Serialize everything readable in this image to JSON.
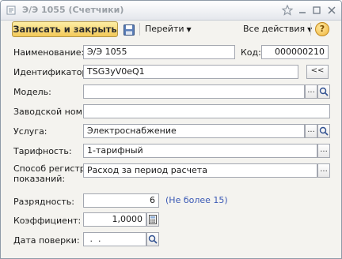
{
  "window": {
    "title": "Э/Э 1055 (Счетчики)"
  },
  "toolbar": {
    "save_close_label": "Записать и закрыть",
    "go_label": "Перейти",
    "actions_label": "Все действия",
    "help_label": "?"
  },
  "form": {
    "name_label": "Наименование:",
    "name_value": "Э/Э 1055",
    "code_label": "Код:",
    "code_value": "000000210",
    "identifier_label": "Идентификатор:",
    "identifier_value": "TSG3yV0eQ1",
    "identifier_btn": "<<",
    "model_label": "Модель:",
    "model_value": "",
    "serial_label": "Заводской ном.:",
    "serial_value": "",
    "service_label": "Услуга:",
    "service_value": "Электроснабжение",
    "tariff_label": "Тарифность:",
    "tariff_value": "1-тарифный",
    "method_label_1": "Способ регистр.",
    "method_label_2": "показаний:",
    "method_value": "Расход за период расчета",
    "digits_label": "Разрядность:",
    "digits_value": "6",
    "digits_hint": "(Не более 15)",
    "coef_label": "Коэффициент:",
    "coef_value": "1,0000",
    "check_date_label": "Дата поверки:",
    "check_date_value": " .  ."
  }
}
